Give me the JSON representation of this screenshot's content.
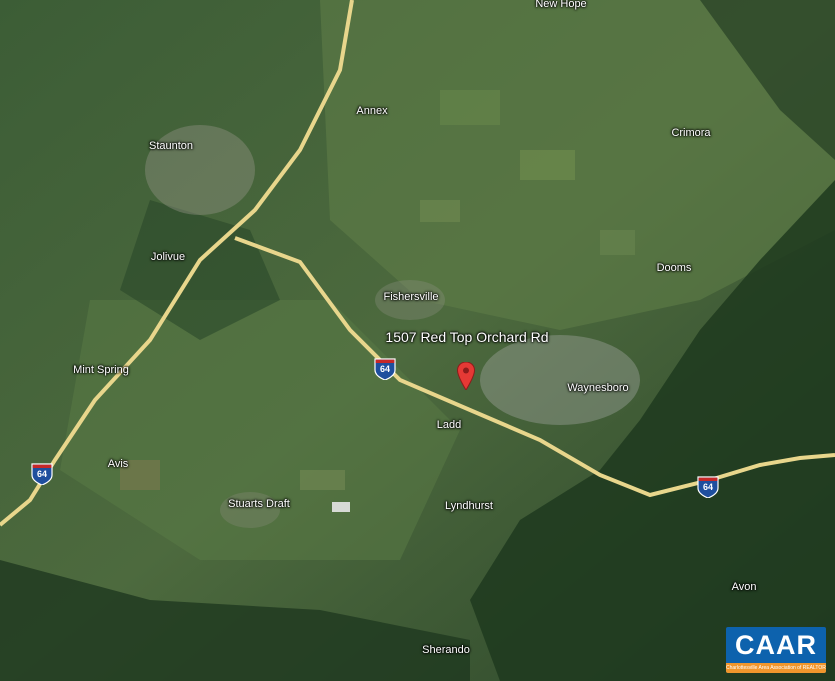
{
  "map": {
    "pin_label": "1507 Red Top Orchard Rd",
    "places": [
      {
        "id": "new-hope",
        "name": "New Hope"
      },
      {
        "id": "annex",
        "name": "Annex"
      },
      {
        "id": "staunton",
        "name": "Staunton"
      },
      {
        "id": "crimora",
        "name": "Crimora"
      },
      {
        "id": "jolivue",
        "name": "Jolivue"
      },
      {
        "id": "dooms",
        "name": "Dooms"
      },
      {
        "id": "fishersville",
        "name": "Fishersville"
      },
      {
        "id": "mint-spring",
        "name": "Mint Spring"
      },
      {
        "id": "waynesboro",
        "name": "Waynesboro"
      },
      {
        "id": "ladd",
        "name": "Ladd"
      },
      {
        "id": "avis",
        "name": "Avis"
      },
      {
        "id": "stuarts-draft",
        "name": "Stuarts Draft"
      },
      {
        "id": "lyndhurst",
        "name": "Lyndhurst"
      },
      {
        "id": "avon",
        "name": "Avon"
      },
      {
        "id": "sherando",
        "name": "Sherando"
      }
    ],
    "highway_shield": "64",
    "colors": {
      "highway": "#e8d68c",
      "pin": "#e53935",
      "shield_blue": "#1f4f9e",
      "shield_red": "#c62828"
    }
  },
  "logo": {
    "name": "CAAR",
    "tagline": "Charlottesville Area Association of REALTORS®",
    "colors": {
      "primary": "#0d62ad",
      "accent": "#f0962c"
    }
  }
}
